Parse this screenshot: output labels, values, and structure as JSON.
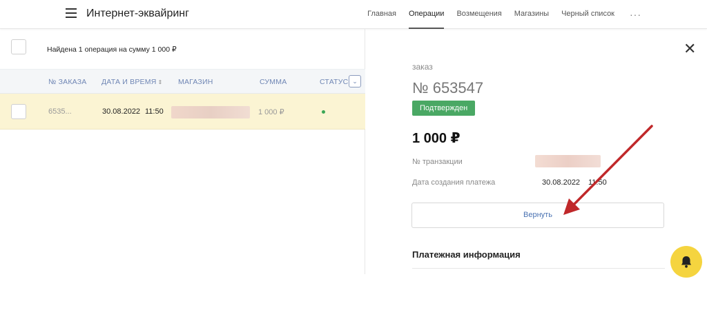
{
  "header": {
    "title": "Интернет-эквайринг",
    "nav": [
      "Главная",
      "Операции",
      "Возмещения",
      "Магазины",
      "Черный список"
    ],
    "active_nav": "Операции",
    "more": "···"
  },
  "operations": {
    "found_text": "Найдена 1 операция на сумму 1 000 ₽",
    "columns": {
      "order": "№ ЗАКАЗА",
      "datetime": "ДАТА И ВРЕМЯ",
      "shop": "МАГАЗИН",
      "amount": "СУММА",
      "status": "СТАТУС"
    },
    "rows": [
      {
        "order": "6535...",
        "date": "30.08.2022",
        "time": "11:50",
        "shop": "",
        "amount": "1 000 ₽",
        "status_color": "#3aa655"
      }
    ]
  },
  "detail": {
    "order_label": "заказ",
    "order_no": "№ 653547",
    "status_badge": "Подтвержден",
    "amount": "1 000 ₽",
    "transaction_label": "№ транзакции",
    "transaction_value": "",
    "created_label": "Дата создания платежа",
    "created_value": "30.08.2022",
    "created_time": "11:50",
    "refund_button": "Вернуть",
    "section_title": "Платежная информация"
  },
  "colors": {
    "accent": "#6f86b4",
    "row_highlight": "#fbf4d3",
    "badge": "#4aa864",
    "bell": "#f5d43f",
    "arrow": "#c0282a"
  },
  "icons": [
    "menu-icon",
    "sort-icon",
    "chevron-down-icon",
    "close-icon",
    "bell-icon",
    "status-dot"
  ]
}
